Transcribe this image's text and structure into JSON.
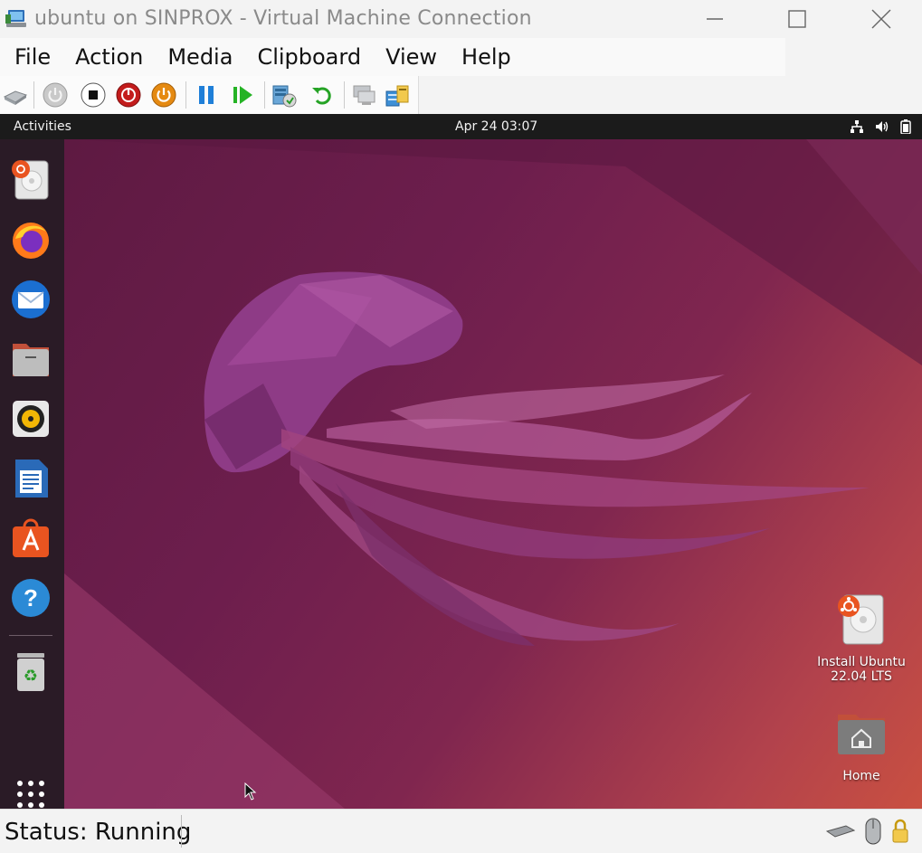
{
  "window": {
    "title": "ubuntu on SINPROX - Virtual Machine Connection",
    "icon": "vm-connection-icon",
    "controls": [
      "minimize",
      "maximize",
      "close"
    ]
  },
  "menubar": {
    "items": [
      {
        "label": "File"
      },
      {
        "label": "Action"
      },
      {
        "label": "Media"
      },
      {
        "label": "Clipboard"
      },
      {
        "label": "View"
      },
      {
        "label": "Help"
      }
    ]
  },
  "toolbar": {
    "buttons": [
      {
        "name": "ctrl-alt-del",
        "icon": "keyboard-icon"
      },
      {
        "name": "start",
        "icon": "power-gray-icon"
      },
      {
        "name": "turn-off",
        "icon": "stop-icon"
      },
      {
        "name": "shut-down",
        "icon": "power-red-icon"
      },
      {
        "name": "save",
        "icon": "power-orange-icon"
      },
      {
        "name": "pause",
        "icon": "pause-icon"
      },
      {
        "name": "resume",
        "icon": "play-icon"
      },
      {
        "name": "checkpoint",
        "icon": "checkpoint-icon"
      },
      {
        "name": "revert",
        "icon": "revert-icon"
      },
      {
        "name": "enhanced-session",
        "icon": "enhanced-session-icon"
      },
      {
        "name": "share",
        "icon": "share-icon"
      }
    ]
  },
  "guest": {
    "topbar": {
      "activities": "Activities",
      "clock": "Apr 24  03:07",
      "tray": [
        "network-icon",
        "volume-icon",
        "battery-icon"
      ]
    },
    "dock": [
      {
        "name": "install-ubuntu",
        "icon": "ubuntu-installer-icon"
      },
      {
        "name": "firefox",
        "icon": "firefox-icon"
      },
      {
        "name": "thunderbird",
        "icon": "thunderbird-icon"
      },
      {
        "name": "files",
        "icon": "files-icon"
      },
      {
        "name": "rhythmbox",
        "icon": "rhythmbox-icon"
      },
      {
        "name": "libreoffice-writer",
        "icon": "writer-icon"
      },
      {
        "name": "ubuntu-software",
        "icon": "software-icon"
      },
      {
        "name": "help",
        "icon": "help-icon"
      },
      {
        "name": "trash",
        "icon": "trash-icon"
      },
      {
        "name": "show-apps",
        "icon": "app-grid-icon"
      }
    ],
    "desktop_icons": [
      {
        "label_line1": "Install Ubuntu",
        "label_line2": "22.04 LTS",
        "icon": "ubuntu-installer-icon"
      },
      {
        "label_line1": "Home",
        "icon": "home-folder-icon"
      }
    ]
  },
  "statusbar": {
    "status": "Status: Running",
    "tray": [
      "keyboard-icon",
      "mouse-icon",
      "lock-icon"
    ]
  }
}
